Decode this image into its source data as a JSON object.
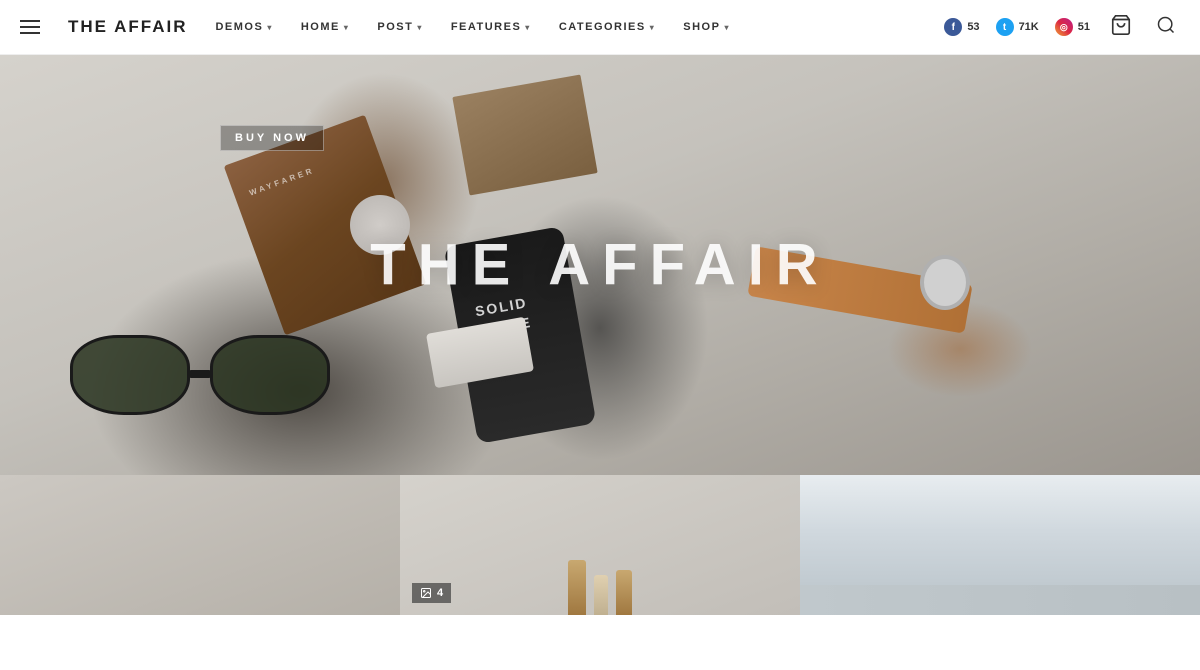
{
  "header": {
    "logo": "THE AFFAIR",
    "nav_items": [
      {
        "label": "DEMOS",
        "has_dropdown": true
      },
      {
        "label": "HOME",
        "has_dropdown": true
      },
      {
        "label": "POST",
        "has_dropdown": true
      },
      {
        "label": "FEATURES",
        "has_dropdown": true
      },
      {
        "label": "CATEGORIES",
        "has_dropdown": true
      },
      {
        "label": "SHOP",
        "has_dropdown": true
      }
    ],
    "social": [
      {
        "platform": "facebook",
        "icon_char": "f",
        "count": "53"
      },
      {
        "platform": "twitter",
        "icon_char": "t",
        "count": "71K"
      },
      {
        "platform": "instagram",
        "icon_char": "i",
        "count": "51"
      }
    ]
  },
  "hero": {
    "title": "THE AFFAIR",
    "buy_now_label": "BUY NOW",
    "phone_text_line1": "SOLID",
    "phone_text_line2": "STATE"
  },
  "grid": {
    "left_cell_bg": "#c5c2bc",
    "mid_cell_bg": "#d0cdc8",
    "right_cell_bg": "#c8ccd0",
    "image_count": "4",
    "image_icon": "▦"
  },
  "icons": {
    "hamburger": "☰",
    "cart": "🛒",
    "search": "🔍",
    "chevron_down": "▾",
    "image_count": "▦"
  }
}
